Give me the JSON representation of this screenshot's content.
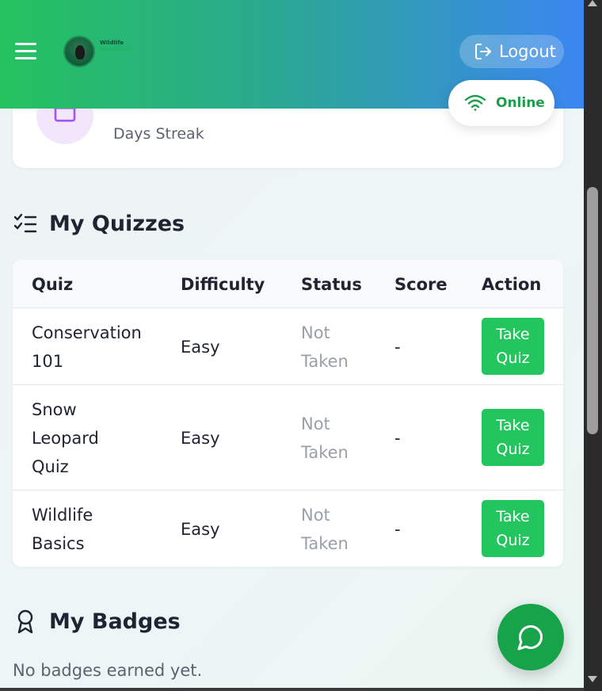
{
  "header": {
    "logo_line1": "Wildlife",
    "logo_line2": "Guardians",
    "logout_label": "Logout",
    "online_label": "Online"
  },
  "streak": {
    "label": "Days Streak"
  },
  "quizzes": {
    "title": "My Quizzes",
    "columns": [
      "Quiz",
      "Difficulty",
      "Status",
      "Score",
      "Action"
    ],
    "rows": [
      {
        "quiz": "Conservation 101",
        "difficulty": "Easy",
        "status": "Not Taken",
        "score": "-",
        "action": "Take Quiz"
      },
      {
        "quiz": "Snow Leopard Quiz",
        "difficulty": "Easy",
        "status": "Not Taken",
        "score": "-",
        "action": "Take Quiz"
      },
      {
        "quiz": "Wildlife Basics",
        "difficulty": "Easy",
        "status": "Not Taken",
        "score": "-",
        "action": "Take Quiz"
      }
    ]
  },
  "badges": {
    "title": "My Badges",
    "empty_text": "No badges earned yet."
  },
  "colors": {
    "accent_green": "#22c55e",
    "online_green": "#1f9d4d",
    "header_gradient_start": "#25c25e",
    "header_gradient_end": "#3b86f1"
  },
  "icons": {
    "menu": "hamburger-icon",
    "logout": "logout-icon",
    "online": "wifi-icon",
    "streak": "calendar-icon",
    "quizzes": "checklist-icon",
    "badges": "award-icon",
    "chat": "chat-bubble-icon"
  }
}
